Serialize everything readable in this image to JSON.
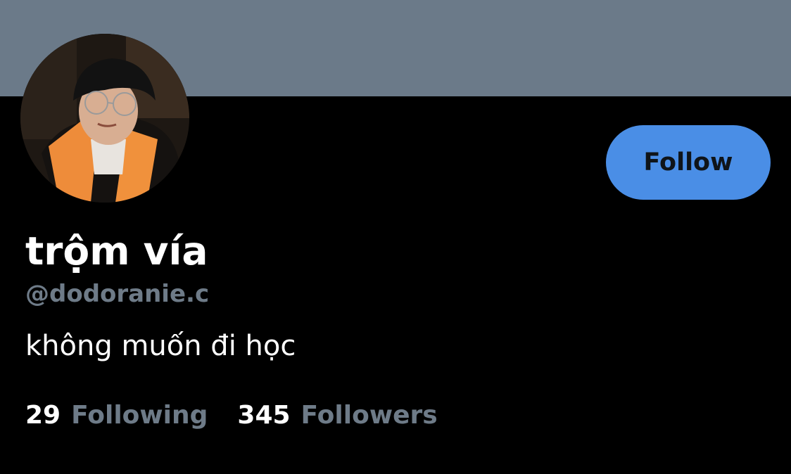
{
  "banner": {
    "color": "#6b7a89"
  },
  "profile": {
    "avatar_icon": "profile-photo",
    "display_name": "trộm vía",
    "handle": "@dodoranie.c",
    "bio": "không muốn đi học"
  },
  "actions": {
    "follow_label": "Follow"
  },
  "stats": {
    "following": {
      "count": "29",
      "label": "Following"
    },
    "followers": {
      "count": "345",
      "label": "Followers"
    }
  },
  "colors": {
    "background": "#000000",
    "accent": "#4a8ee6",
    "secondary_text": "#6e7b88",
    "primary_text": "#ffffff"
  }
}
